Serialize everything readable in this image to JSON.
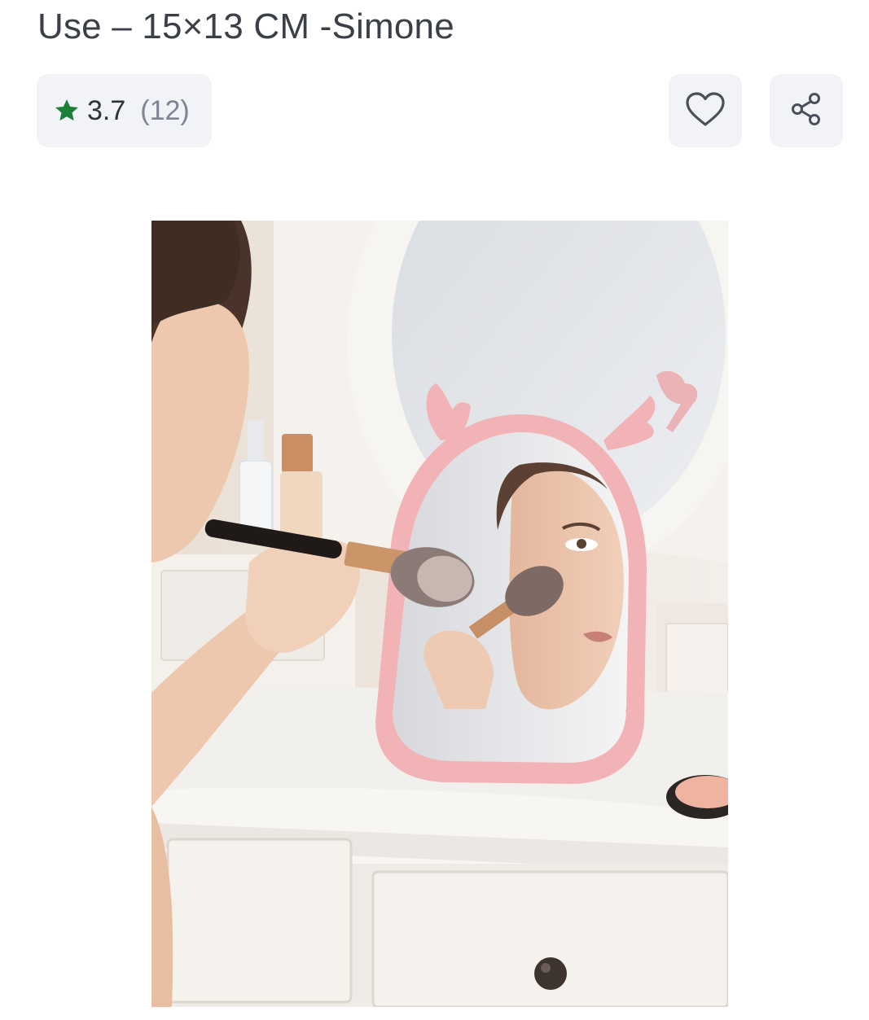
{
  "product": {
    "title": "Use – 15×13 CM -Simone",
    "rating": {
      "value": "3.7",
      "count": "(12)",
      "star_color": "#1a7f37"
    }
  },
  "actions": {
    "wishlist_icon": "heart-outline-icon",
    "share_icon": "share-icon"
  },
  "image": {
    "subject": "pink-deer-antler-tabletop-mirror",
    "accent_color": "#f2b3b6"
  }
}
